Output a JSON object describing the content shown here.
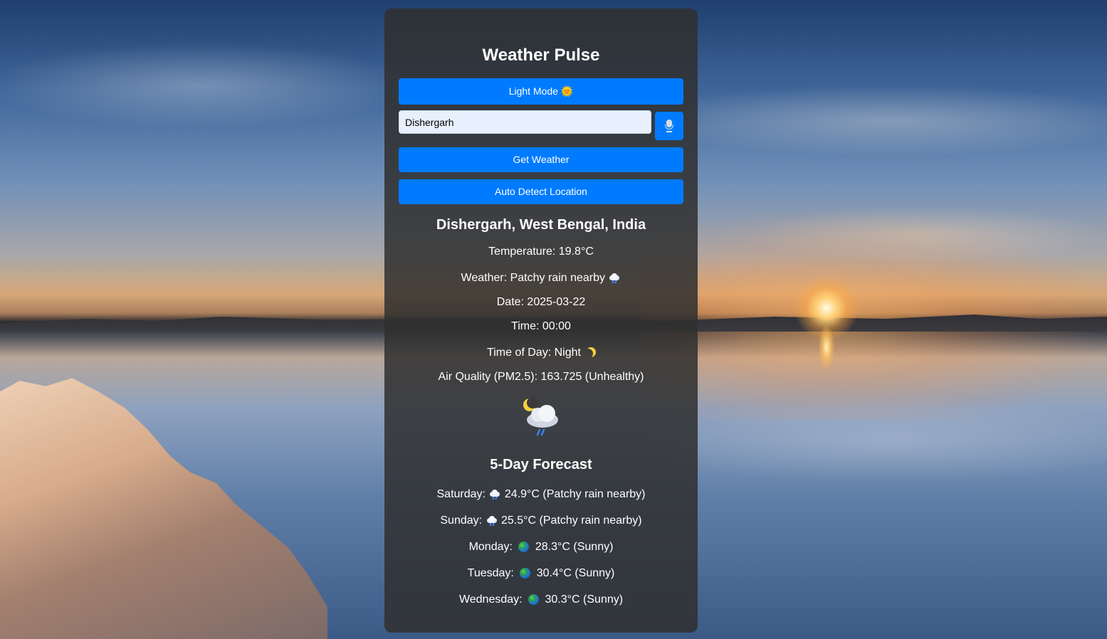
{
  "app": {
    "title": "Weather Pulse"
  },
  "controls": {
    "theme_button": "Light Mode 🌞",
    "search_value": "Dishergarh",
    "get_weather_button": "Get Weather",
    "auto_detect_button": "Auto Detect Location"
  },
  "current": {
    "location": "Dishergarh, West Bengal, India",
    "temperature": "Temperature: 19.8°C",
    "weather": "Weather: Patchy rain nearby",
    "date": "Date: 2025-03-22",
    "time": "Time: 00:00",
    "time_of_day": "Time of Day: Night",
    "air_quality": "Air Quality (PM2.5): 163.725 (Unhealthy)",
    "icon": "night-rain-cloud-icon"
  },
  "forecast": {
    "title": "5-Day Forecast",
    "days": [
      {
        "day": "Saturday:",
        "icon": "rain-cloud-icon",
        "summary": "24.9°C (Patchy rain nearby)"
      },
      {
        "day": "Sunday:",
        "icon": "rain-cloud-icon",
        "summary": "25.5°C (Patchy rain nearby)"
      },
      {
        "day": "Monday:",
        "icon": "globe-icon",
        "summary": "28.3°C (Sunny)"
      },
      {
        "day": "Tuesday:",
        "icon": "globe-icon",
        "summary": "30.4°C (Sunny)"
      },
      {
        "day": "Wednesday:",
        "icon": "globe-icon",
        "summary": "30.3°C (Sunny)"
      }
    ]
  },
  "colors": {
    "accent": "#007bff",
    "card": "#303030",
    "text": "#ffffff"
  }
}
